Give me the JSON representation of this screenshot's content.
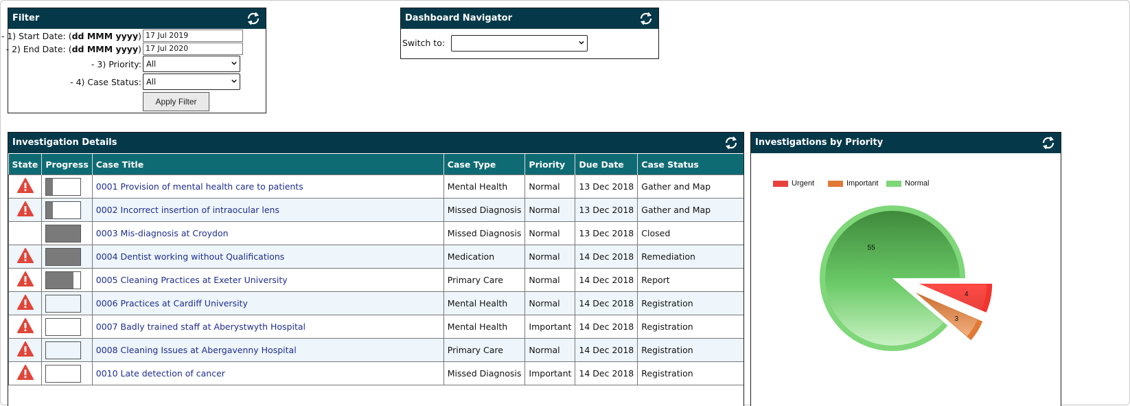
{
  "filter": {
    "title": "Filter",
    "start_label_prefix": "- 1) Start Date: (",
    "start_label_fmt": "dd MMM yyyy",
    "start_label_suffix": ")",
    "start_value": "17 Jul 2019",
    "end_label_prefix": "- 2) End Date: (",
    "end_label_fmt": "dd MMM yyyy",
    "end_label_suffix": ")",
    "end_value": "17 Jul 2020",
    "priority_label": "- 3) Priority:",
    "priority_value": "All",
    "status_label": "- 4) Case Status:",
    "status_value": "All",
    "apply_label": "Apply Filter"
  },
  "navigator": {
    "title": "Dashboard Navigator",
    "switch_label": "Switch to:",
    "switch_value": ""
  },
  "investigations": {
    "title": "Investigation Details",
    "columns": [
      "State",
      "Progress",
      "Case Title",
      "Case Type",
      "Priority",
      "Due Date",
      "Case Status"
    ],
    "rows": [
      {
        "warning": true,
        "progress": 0.2,
        "title": "0001 Provision of mental health care to patients",
        "type": "Mental Health",
        "priority": "Normal",
        "due": "13 Dec 2018",
        "status": "Gather and Map"
      },
      {
        "warning": true,
        "progress": 0.2,
        "title": "0002 Incorrect insertion of intraocular lens",
        "type": "Missed Diagnosis",
        "priority": "Normal",
        "due": "13 Dec 2018",
        "status": "Gather and Map"
      },
      {
        "warning": false,
        "progress": 1.0,
        "title": "0003 Mis-diagnosis at Croydon",
        "type": "Missed Diagnosis",
        "priority": "Normal",
        "due": "13 Dec 2018",
        "status": "Closed"
      },
      {
        "warning": true,
        "progress": 1.0,
        "title": "0004 Dentist working without Qualifications",
        "type": "Medication",
        "priority": "Normal",
        "due": "14 Dec 2018",
        "status": "Remediation"
      },
      {
        "warning": true,
        "progress": 0.8,
        "title": "0005 Cleaning Practices at Exeter University",
        "type": "Primary Care",
        "priority": "Normal",
        "due": "14 Dec 2018",
        "status": "Report"
      },
      {
        "warning": true,
        "progress": 0.0,
        "title": "0006 Practices at Cardiff University",
        "type": "Mental Health",
        "priority": "Normal",
        "due": "14 Dec 2018",
        "status": "Registration"
      },
      {
        "warning": true,
        "progress": 0.0,
        "title": "0007 Badly trained staff at Aberystwyth Hospital",
        "type": "Mental Health",
        "priority": "Important",
        "due": "14 Dec 2018",
        "status": "Registration"
      },
      {
        "warning": true,
        "progress": 0.0,
        "title": "0008 Cleaning Issues at Abergavenny Hospital",
        "type": "Primary Care",
        "priority": "Normal",
        "due": "14 Dec 2018",
        "status": "Registration"
      },
      {
        "warning": true,
        "progress": 0.0,
        "title": "0010 Late detection of cancer",
        "type": "Missed Diagnosis",
        "priority": "Important",
        "due": "14 Dec 2018",
        "status": "Registration"
      }
    ]
  },
  "priority_chart": {
    "title": "Investigations by Priority"
  },
  "chart_data": {
    "type": "pie",
    "title": "Investigations by Priority",
    "legend_position": "top-left",
    "categories": [
      "Urgent",
      "Important",
      "Normal"
    ],
    "values": [
      4,
      3,
      55
    ],
    "colors": [
      "#e8413c",
      "#e07a36",
      "#7fd77a"
    ],
    "exploded": [
      "Urgent",
      "Important"
    ]
  },
  "colors": {
    "header_bg": "#05394a",
    "table_header_bg": "#0f6b73",
    "link": "#1e2d8f",
    "warning": "#e0453a"
  }
}
